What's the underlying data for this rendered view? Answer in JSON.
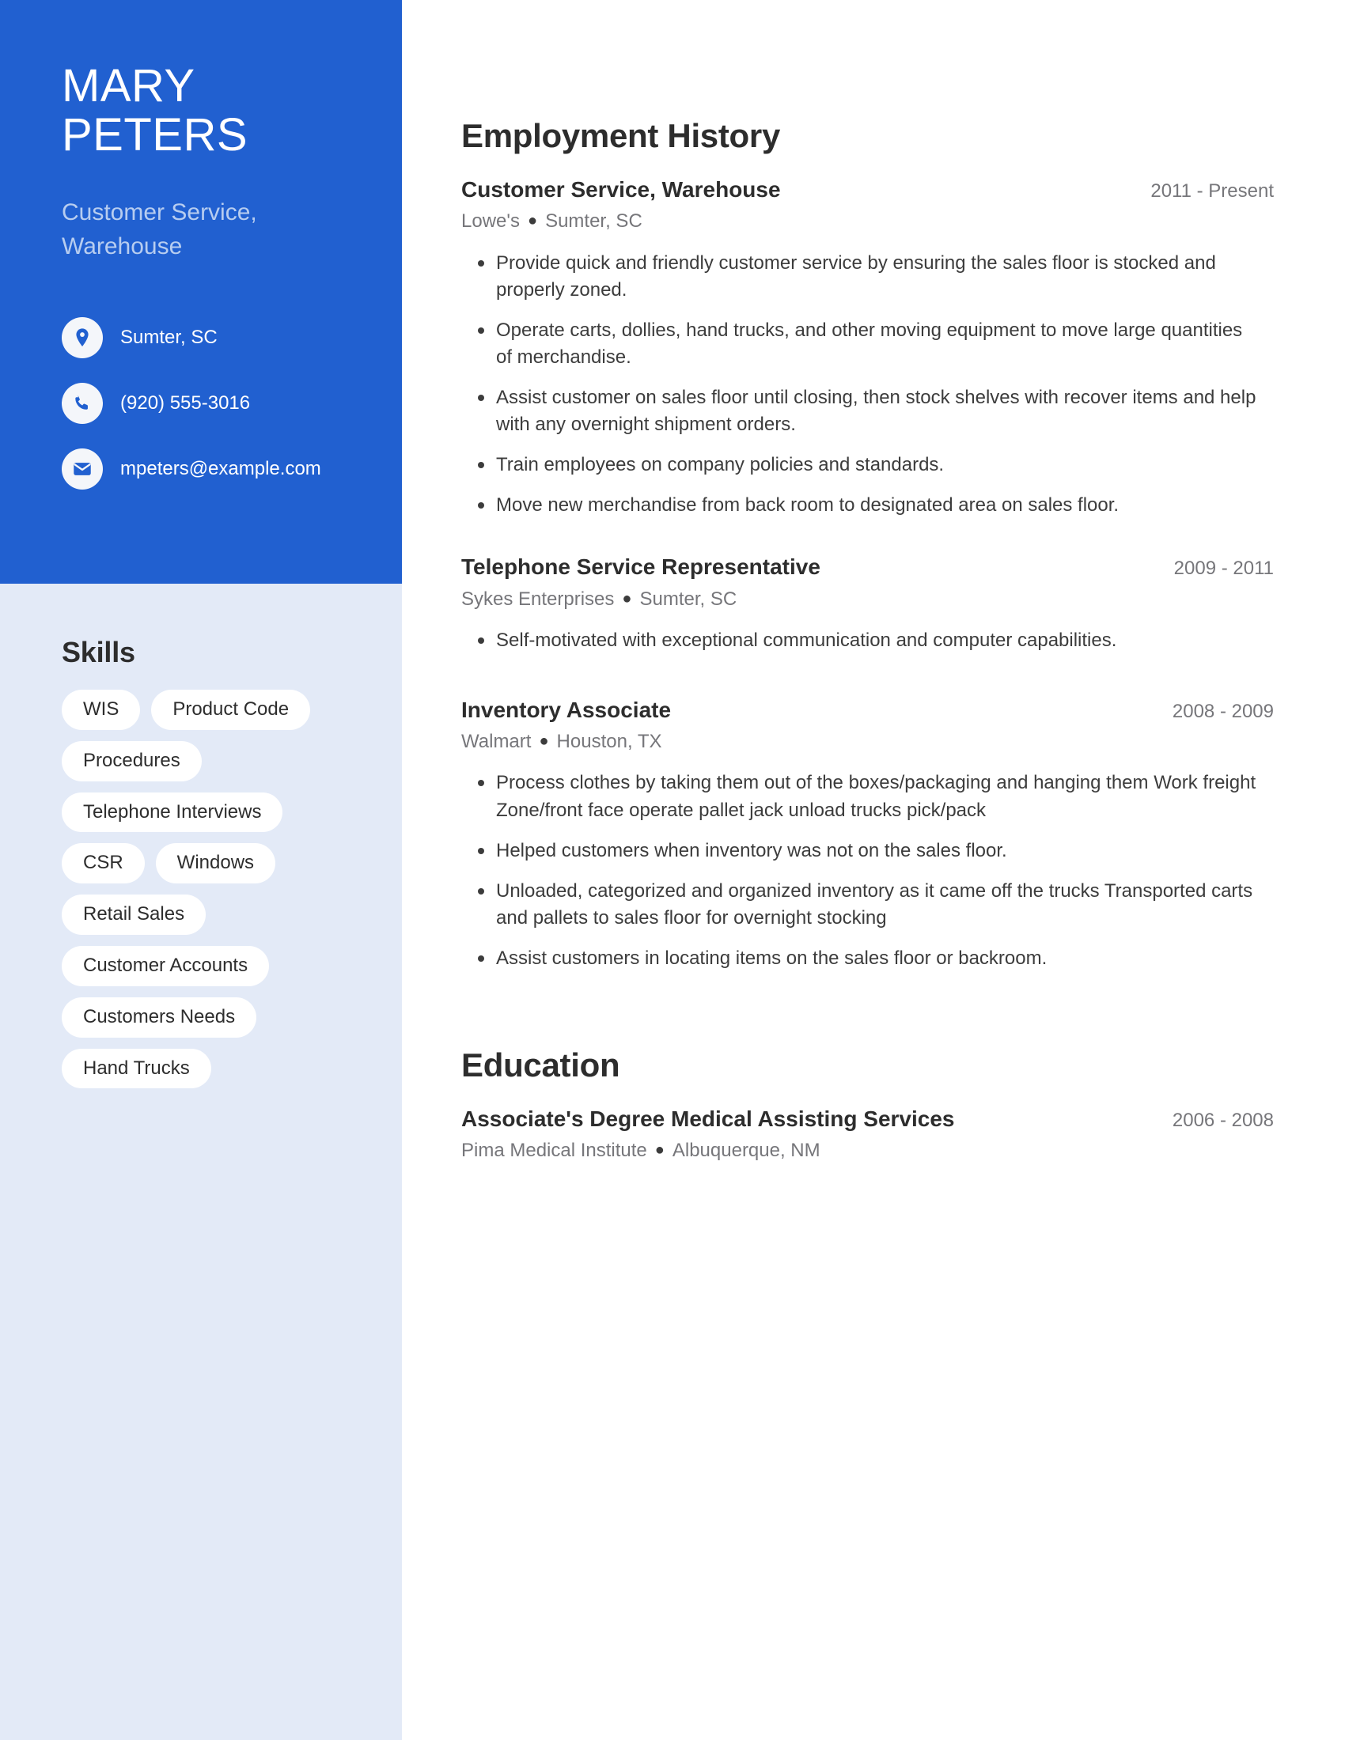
{
  "profile": {
    "first_name": "MARY",
    "last_name": "PETERS",
    "subtitle": "Customer Service, Warehouse"
  },
  "colors": {
    "header_blue": "#2160d0",
    "sidebar_light": "#e3eaf7",
    "subtitle_blue": "#b7cdf0",
    "pill_white": "#ffffff",
    "text_dark": "#2d2d2d",
    "text_muted": "#76767a"
  },
  "contact": [
    {
      "icon": "location-pin-icon",
      "value": "Sumter, SC"
    },
    {
      "icon": "phone-icon",
      "value": "(920) 555-3016"
    },
    {
      "icon": "email-icon",
      "value": "mpeters@example.com"
    }
  ],
  "skills": {
    "title": "Skills",
    "rows": [
      [
        "WIS",
        "Product Code"
      ],
      [
        "Procedures"
      ],
      [
        "Telephone Interviews"
      ],
      [
        "CSR",
        "Windows"
      ],
      [
        "Retail Sales"
      ],
      [
        "Customer Accounts"
      ],
      [
        "Customers Needs"
      ],
      [
        "Hand Trucks"
      ]
    ]
  },
  "employment": {
    "title": "Employment History",
    "entries": [
      {
        "title": "Customer Service, Warehouse",
        "date": "2011 - Present",
        "company": "Lowe's",
        "location": "Sumter, SC",
        "bullets": [
          "Provide quick and friendly customer service by ensuring the sales floor is stocked and properly zoned.",
          "Operate carts, dollies, hand trucks, and other moving equipment to move large quantities of merchandise.",
          "Assist customer on sales floor until closing, then stock shelves with recover items and help with any overnight shipment orders.",
          "Train employees on company policies and standards.",
          "Move new merchandise from back room to designated area on sales floor."
        ]
      },
      {
        "title": "Telephone Service Representative",
        "date": "2009 - 2011",
        "company": "Sykes Enterprises",
        "location": "Sumter, SC",
        "bullets": [
          "Self-motivated with exceptional communication and computer capabilities."
        ]
      },
      {
        "title": "Inventory Associate",
        "date": "2008 - 2009",
        "company": "Walmart",
        "location": "Houston, TX",
        "bullets": [
          "Process clothes by taking them out of the boxes/packaging and hanging them Work freight Zone/front face operate pallet jack unload trucks pick/pack",
          "Helped customers when inventory was not on the sales floor.",
          "Unloaded, categorized and organized inventory as it came off the trucks Transported carts and pallets to sales floor for overnight stocking",
          "Assist customers in locating items on the sales floor or backroom."
        ]
      }
    ]
  },
  "education": {
    "title": "Education",
    "entries": [
      {
        "title": "Associate's Degree Medical Assisting Services",
        "date": "2006 - 2008",
        "school": "Pima Medical Institute",
        "location": "Albuquerque, NM"
      }
    ]
  }
}
